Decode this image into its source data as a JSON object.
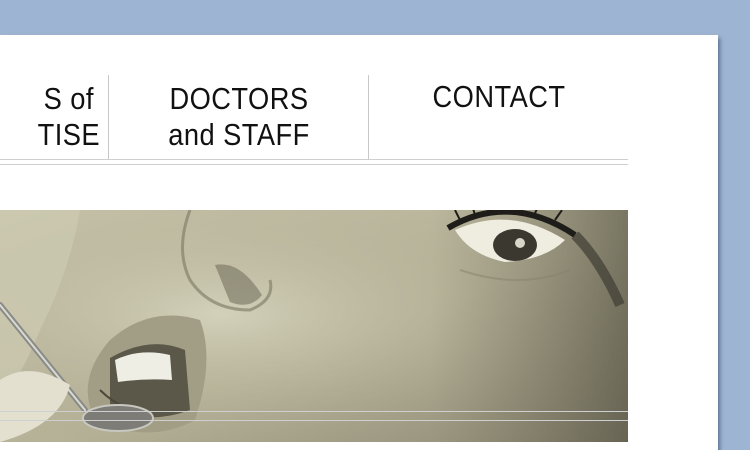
{
  "nav": {
    "items": [
      {
        "line1": "S of",
        "line2": "TISE"
      },
      {
        "line1": "DOCTORS",
        "line2": "and STAFF"
      },
      {
        "line1": "CONTACT",
        "line2": ""
      }
    ]
  },
  "colors": {
    "background": "#9db5d2",
    "panel": "#ffffff",
    "hero_tone": "#b6b298"
  },
  "hero": {
    "image": "sepia dental photograph of a woman's face with a dental mirror"
  }
}
